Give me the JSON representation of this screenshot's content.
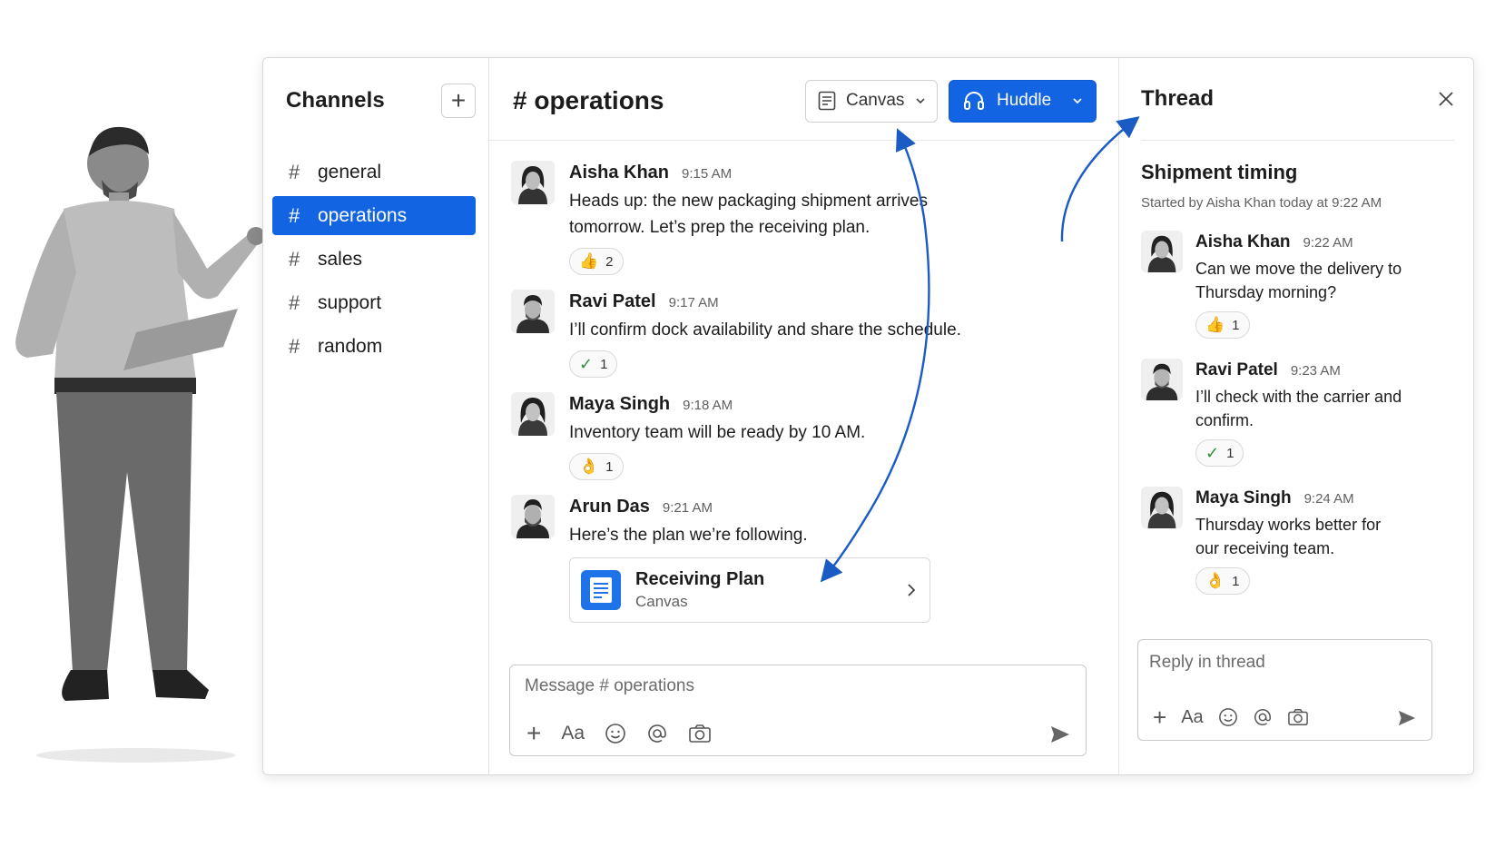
{
  "sidebar": {
    "title": "Channels",
    "add_icon": "plus-icon",
    "channels": [
      {
        "label": "general",
        "active": false
      },
      {
        "label": "operations",
        "active": true
      },
      {
        "label": "sales",
        "active": false
      },
      {
        "label": "support",
        "active": false
      },
      {
        "label": "random",
        "active": false
      }
    ]
  },
  "main": {
    "title": "# operations",
    "canvas_button": "Canvas",
    "huddle_button": "Huddle",
    "messages": [
      {
        "name": "Aisha Khan",
        "time": "9:15 AM",
        "text": "Heads up: the new packaging shipment arrives tomorrow. Let’s prep the receiving plan.",
        "reaction": {
          "emoji": "👍",
          "count": "2"
        }
      },
      {
        "name": "Ravi Patel",
        "time": "9:17 AM",
        "text": "I’ll confirm dock availability and share the schedule.",
        "reaction": {
          "emoji": "✓",
          "count": "1"
        }
      },
      {
        "name": "Maya Singh",
        "time": "9:18 AM",
        "text": "Inventory team will be ready by 10 AM.",
        "reaction": {
          "emoji": "👌",
          "count": "1"
        }
      },
      {
        "name": "Arun Das",
        "time": "9:21 AM",
        "text": "Here’s the plan we’re following."
      }
    ],
    "canvas_card": {
      "title": "Receiving Plan",
      "subtitle": "Canvas"
    },
    "composer_placeholder": "Message # operations",
    "composer_tools": {
      "plus": "+",
      "format": "Aa"
    }
  },
  "thread": {
    "title": "Thread",
    "topic": "Shipment timing",
    "started": "Started by Aisha Khan today at 9:22 AM",
    "messages": [
      {
        "name": "Aisha Khan",
        "time": "9:22 AM",
        "text": "Can we move the delivery to Thursday morning?",
        "reaction": {
          "emoji": "👍",
          "count": "1"
        }
      },
      {
        "name": "Ravi Patel",
        "time": "9:23 AM",
        "text": "I’ll check with the carrier and confirm.",
        "reaction": {
          "emoji": "✓",
          "count": "1"
        }
      },
      {
        "name": "Maya Singh",
        "time": "9:24 AM",
        "text": "Thursday works better for our receiving team.",
        "reaction": {
          "emoji": "👌",
          "count": "1"
        }
      }
    ],
    "reply_placeholder": "Reply in thread",
    "reply_tools": {
      "plus": "+",
      "format": "Aa"
    }
  },
  "colors": {
    "accent": "#1264e3",
    "arrow": "#1a5bc4"
  }
}
